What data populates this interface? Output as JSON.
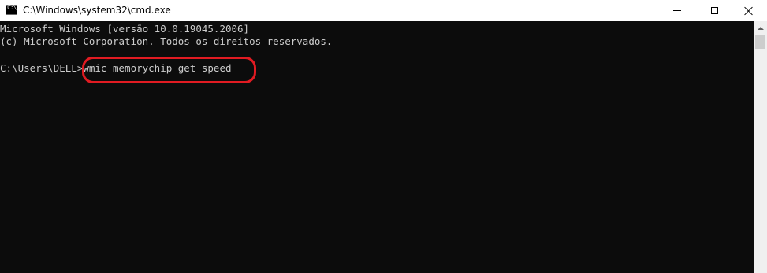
{
  "window": {
    "title": "C:\\Windows\\system32\\cmd.exe",
    "icon": "cmd-icon",
    "icon_glyph": "C:\\",
    "buttons": {
      "minimize_icon": "minimize-icon",
      "maximize_icon": "maximize-icon",
      "close_icon": "close-icon"
    }
  },
  "console": {
    "lines": [
      "Microsoft Windows [versão 10.0.19045.2006]",
      "(c) Microsoft Corporation. Todos os direitos reservados.",
      "C:\\Users\\DELL>wmic memorychip get speed"
    ],
    "background": "#0c0c0c",
    "text_color": "#cccccc"
  },
  "annotation": {
    "color": "#e11b22"
  }
}
